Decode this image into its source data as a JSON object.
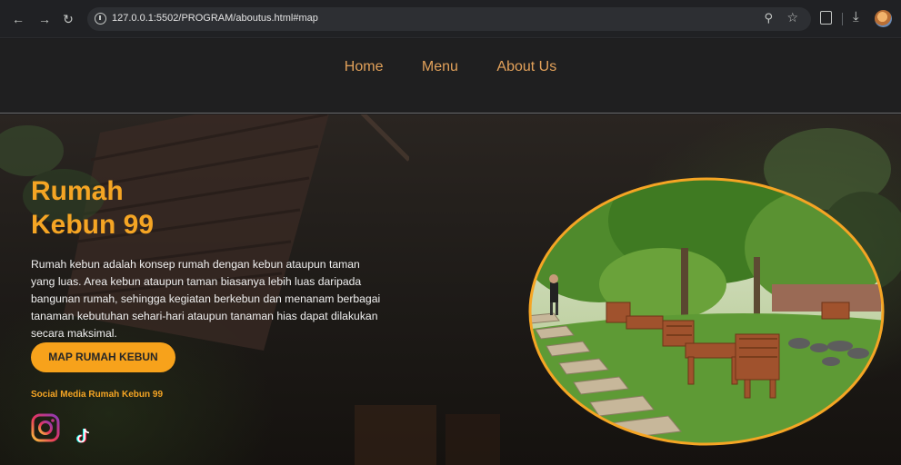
{
  "browser": {
    "url": "127.0.0.1:5502/PROGRAM/aboutus.html#map",
    "back_icon": "arrow-left-icon",
    "forward_icon": "arrow-right-icon",
    "reload_icon": "reload-icon"
  },
  "nav": {
    "items": [
      {
        "label": "Home"
      },
      {
        "label": "Menu"
      },
      {
        "label": "About Us"
      }
    ]
  },
  "hero": {
    "title_line1": "Rumah",
    "title_line2": "Kebun 99",
    "description": "Rumah kebun adalah konsep rumah dengan kebun ataupun taman yang luas. Area kebun ataupun taman biasanya lebih luas daripada bangunan rumah, sehingga kegiatan berkebun dan menanam berbagai tanaman kebutuhan sehari-hari ataupun tanaman hias dapat dilakukan secara maksimal.",
    "button_label": "MAP RUMAH KEBUN",
    "social_title": "Social Media Rumah Kebun 99"
  },
  "colors": {
    "accent": "#f5a524",
    "nav_text": "#e2a15a",
    "header_bg": "#1f1f20"
  }
}
